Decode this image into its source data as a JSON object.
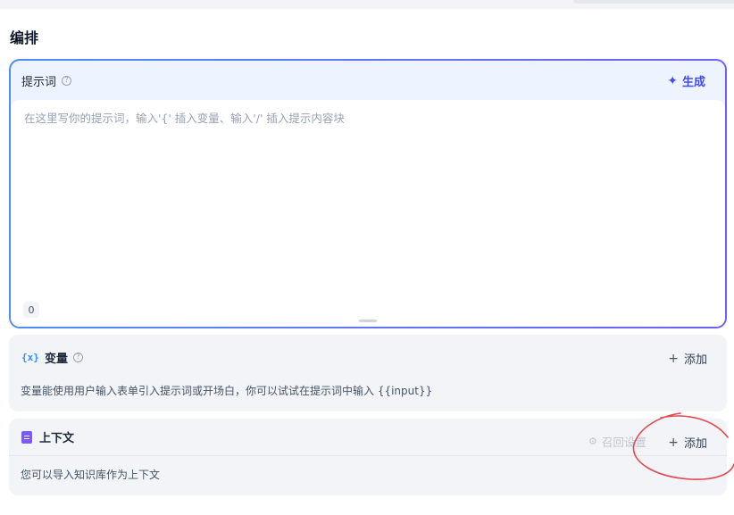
{
  "section_title": "编排",
  "prompt": {
    "label": "提示词",
    "help_icon": "?",
    "generate_label": "生成",
    "placeholder": "在这里写你的提示词，输入'{' 插入变量、输入'/' 插入提示内容块",
    "char_count": "0"
  },
  "variables": {
    "icon": "{x}",
    "title": "变量",
    "add_label": "添加",
    "description": "变量能使用用户输入表单引入提示词或开场白，你可以试试在提示词中输入 {{input}}"
  },
  "context": {
    "title": "上下文",
    "recall_label": "召回设置",
    "add_label": "添加",
    "description": "您可以导入知识库作为上下文"
  },
  "colors": {
    "accent": "#444ce7",
    "gradient_start": "#4f8df6",
    "gradient_end": "#6e61f1",
    "annotation": "#e5484d"
  }
}
